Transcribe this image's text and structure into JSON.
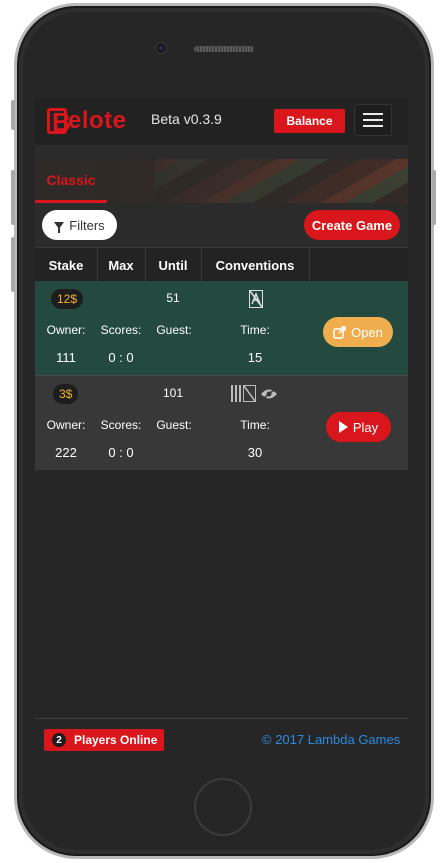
{
  "navbar": {
    "logo_letter": "B",
    "logo_text": "elote",
    "version": "Beta v0.3.9",
    "balance_label": "Balance"
  },
  "tabs": [
    {
      "label": "Classic",
      "active": true
    }
  ],
  "toolbar": {
    "filters_label": "Filters",
    "create_label": "Create Game"
  },
  "table": {
    "headers": [
      "Stake",
      "Max",
      "Until",
      "Conventions"
    ],
    "sub_labels": {
      "owner": "Owner:",
      "scores": "Scores:",
      "guest": "Guest:",
      "time": "Time:"
    },
    "rows": [
      {
        "stake": "12$",
        "max": "",
        "until": "51",
        "owner": "111",
        "scores": "0 : 0",
        "guest": "",
        "time": "15",
        "action": "Open",
        "conventions_icons": [
          "no-trump-icon"
        ],
        "row_color": "#244a40"
      },
      {
        "stake": "3$",
        "max": "",
        "until": "101",
        "owner": "222",
        "scores": "0 : 0",
        "guest": "",
        "time": "30",
        "action": "Play",
        "conventions_icons": [
          "cards-icon",
          "no-trump-icon",
          "eye-icon"
        ],
        "row_color": "#383838"
      }
    ]
  },
  "footer": {
    "players_count": "2",
    "players_label": "Players Online",
    "copyright": "© 2017 Lambda Games"
  },
  "colors": {
    "brand": "#d9161b",
    "open": "#f0ad4e",
    "link": "#2a8be0",
    "stake": "#f0b429"
  }
}
